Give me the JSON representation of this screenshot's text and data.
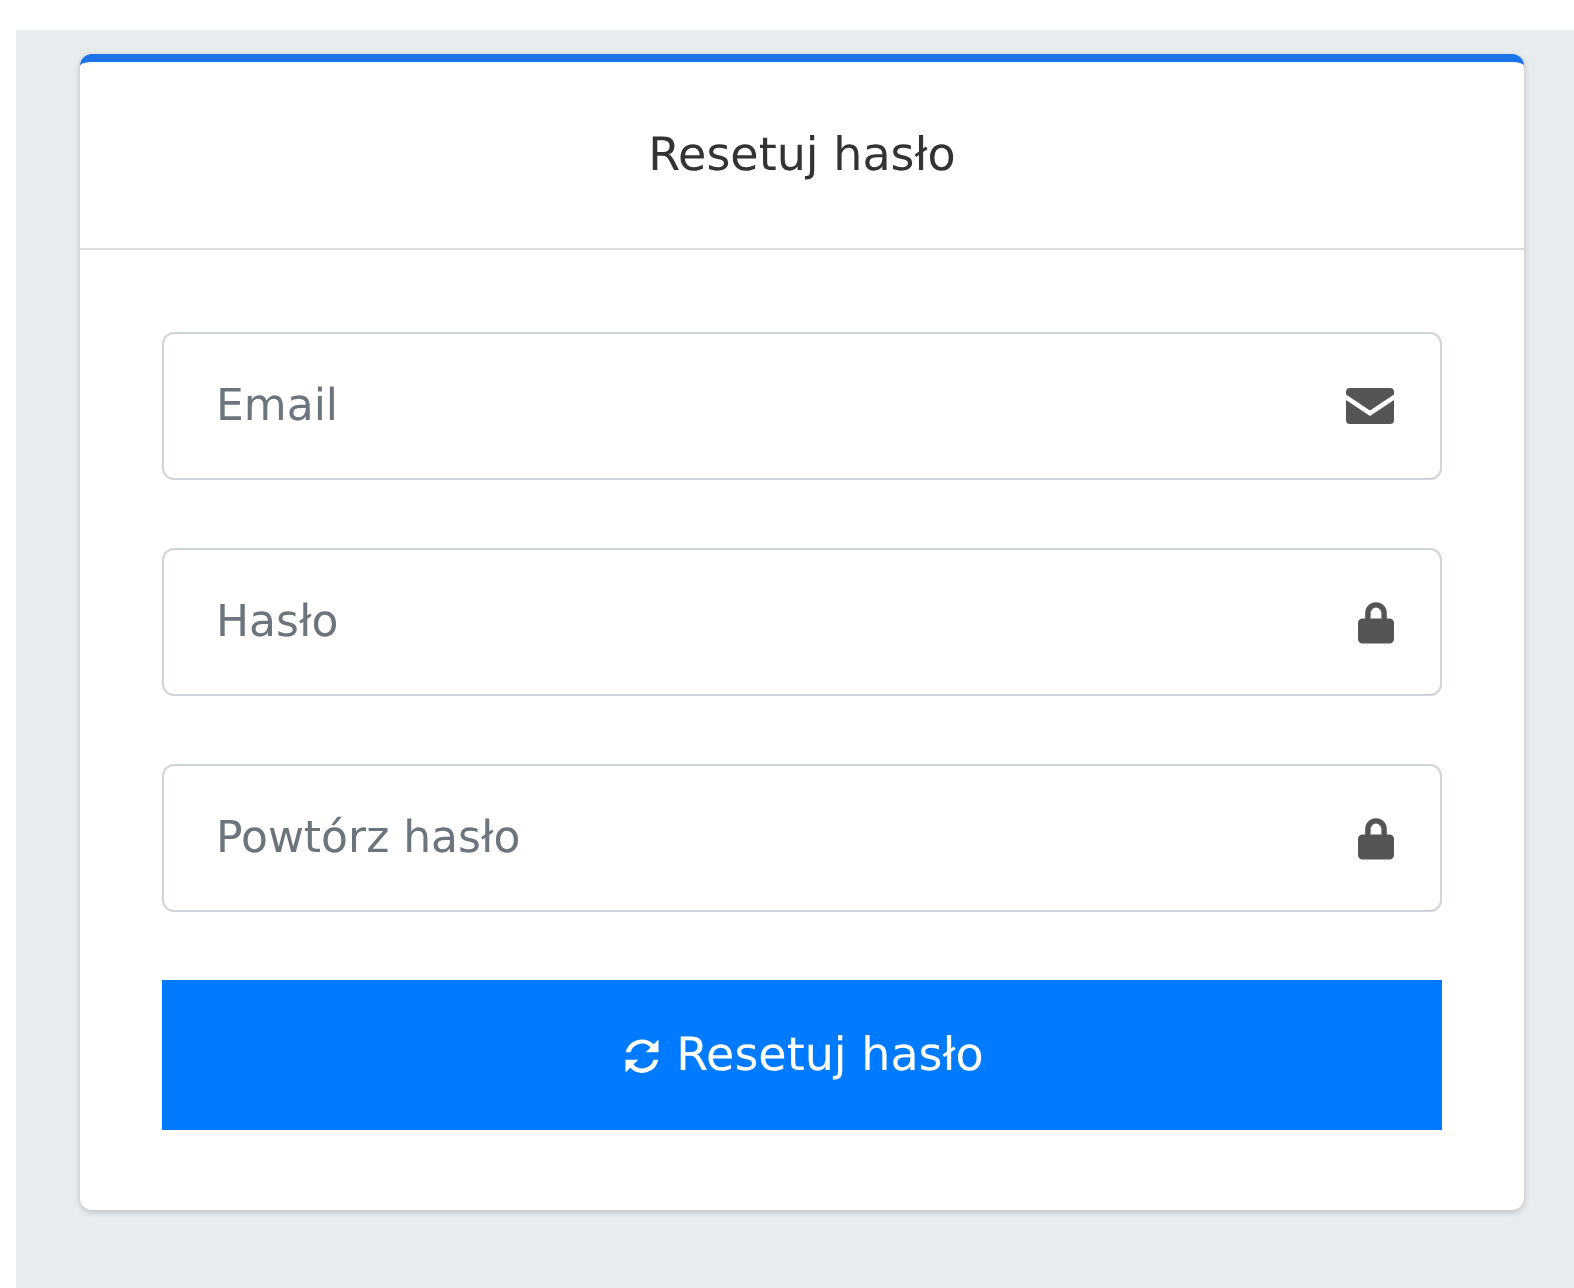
{
  "card": {
    "title": "Resetuj hasło"
  },
  "fields": [
    {
      "placeholder": "Email",
      "kind": "envelope"
    },
    {
      "placeholder": "Hasło",
      "kind": "lock"
    },
    {
      "placeholder": "Powtórz hasło",
      "kind": "lock"
    }
  ],
  "submit": {
    "label": "Resetuj hasło",
    "kind": "refresh"
  }
}
